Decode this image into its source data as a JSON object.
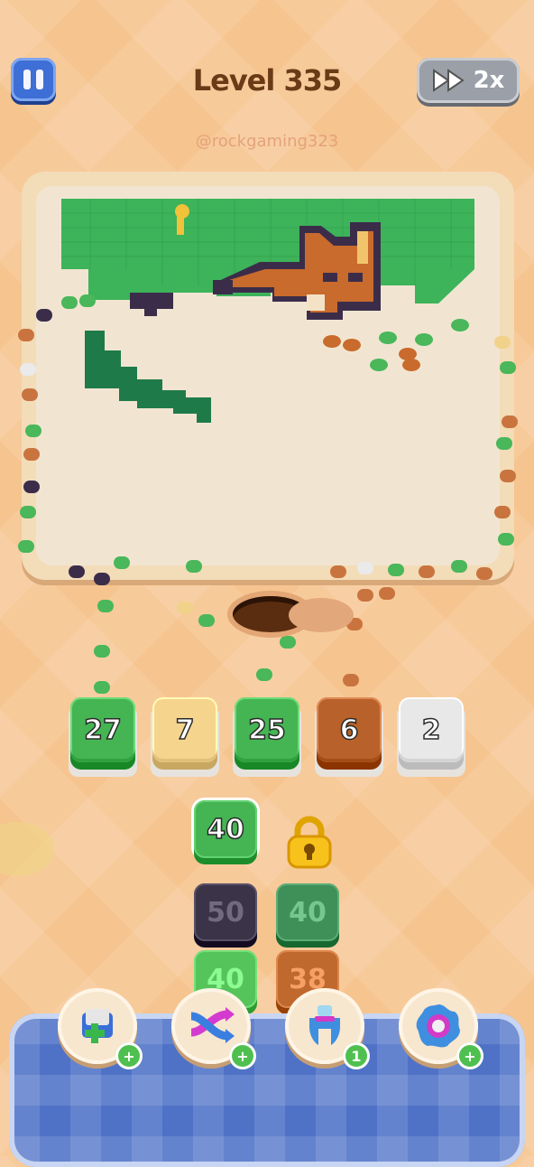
{
  "header": {
    "level_title": "Level 335",
    "speed_label": "2x",
    "watermark": "@rockgaming323"
  },
  "queue_tiles": [
    {
      "value": "27",
      "color": "#45b553"
    },
    {
      "value": "7",
      "color": "#f5d48e"
    },
    {
      "value": "25",
      "color": "#45b553"
    },
    {
      "value": "6",
      "color": "#b8612a"
    },
    {
      "value": "2",
      "color": "#e8e8e8"
    }
  ],
  "stack_tiles": [
    {
      "value": "40",
      "color": "#45b553",
      "column": 0,
      "row": 0
    },
    {
      "value": "50",
      "color": "#3b3449",
      "column": 0,
      "row": 1
    },
    {
      "value": "40",
      "color": "#3f8f58",
      "column": 1,
      "row": 1
    },
    {
      "value": "40",
      "color": "#55c45a",
      "column": 0,
      "row": 2
    },
    {
      "value": "38",
      "color": "#c0692e",
      "column": 1,
      "row": 2
    }
  ],
  "boosters": [
    {
      "icon": "add-slot-icon",
      "badge": "+"
    },
    {
      "icon": "shuffle-arrows-icon",
      "badge": "+"
    },
    {
      "icon": "magnet-claw-icon",
      "badge": "1"
    },
    {
      "icon": "donut-icon",
      "badge": "+"
    }
  ],
  "colors": {
    "grass": "#3db35a",
    "dark_green": "#1f7a4a",
    "fox_orange": "#c96b2c",
    "fox_dark": "#3b2d4a",
    "accent_blue": "#3e6fd6"
  }
}
